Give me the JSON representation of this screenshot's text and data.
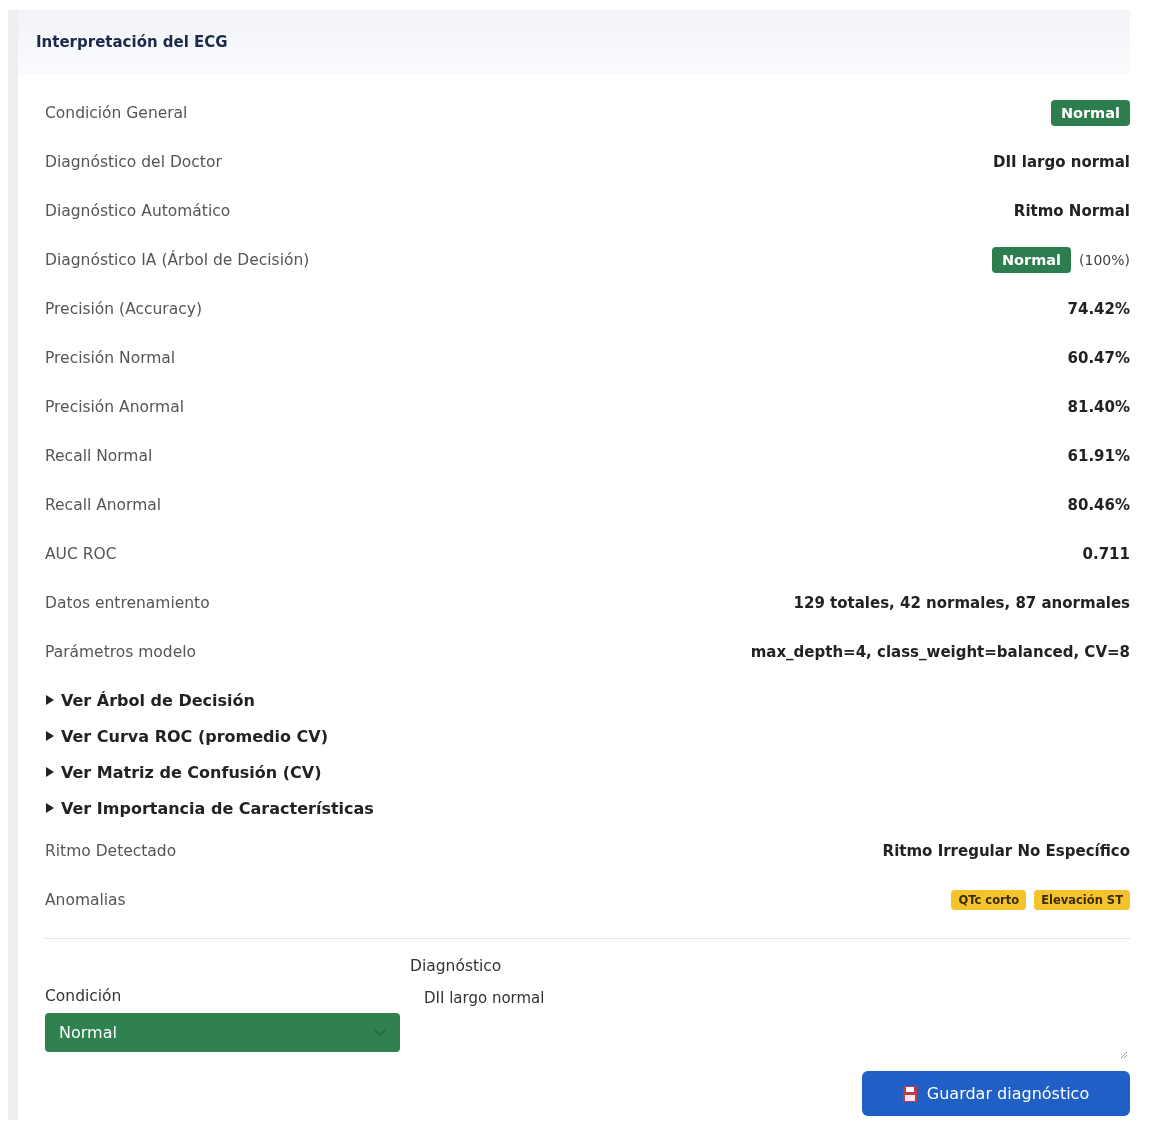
{
  "card": {
    "title": "Interpretación del ECG"
  },
  "rows": [
    {
      "kind": "badge",
      "label": "Condición General",
      "value": "Normal"
    },
    {
      "kind": "text",
      "label": "Diagnóstico del Doctor",
      "value": "DII largo normal"
    },
    {
      "kind": "text",
      "label": "Diagnóstico Automático",
      "value": "Ritmo Normal"
    },
    {
      "kind": "badge_note",
      "label": "Diagnóstico IA (Árbol de Decisión)",
      "value": "Normal",
      "note": "(100%)"
    },
    {
      "kind": "text",
      "label": "Precisión (Accuracy)",
      "value": "74.42%"
    },
    {
      "kind": "text",
      "label": "Precisión Normal",
      "value": "60.47%"
    },
    {
      "kind": "text",
      "label": "Precisión Anormal",
      "value": "81.40%"
    },
    {
      "kind": "text",
      "label": "Recall Normal",
      "value": "61.91%"
    },
    {
      "kind": "text",
      "label": "Recall Anormal",
      "value": "80.46%"
    },
    {
      "kind": "text",
      "label": "AUC ROC",
      "value": "0.711"
    },
    {
      "kind": "text",
      "label": "Datos entrenamiento",
      "value": "129 totales, 42 normales, 87 anormales"
    },
    {
      "kind": "text",
      "label": "Parámetros modelo",
      "value": "max_depth=4, class_weight=balanced, CV=8"
    }
  ],
  "sections": [
    {
      "label": "Ver Árbol de Decisión",
      "expanded": false
    },
    {
      "label": "Ver Curva ROC (promedio CV)",
      "expanded": false
    },
    {
      "label": "Ver Matriz de Confusión (CV)",
      "expanded": false
    },
    {
      "label": "Ver Importancia de Características",
      "expanded": false
    }
  ],
  "rows_after": [
    {
      "kind": "text",
      "label": "Ritmo Detectado",
      "value": "Ritmo Irregular No Específico"
    },
    {
      "kind": "tags",
      "label": "Anomalias",
      "tags": [
        "QTc corto",
        "Elevación ST"
      ]
    }
  ],
  "form": {
    "condition_label": "Condición",
    "condition_value": "Normal",
    "diagnosis_label": "Diagnóstico",
    "diagnosis_value": "DII largo normal",
    "save_button": "Guardar diagnóstico"
  }
}
